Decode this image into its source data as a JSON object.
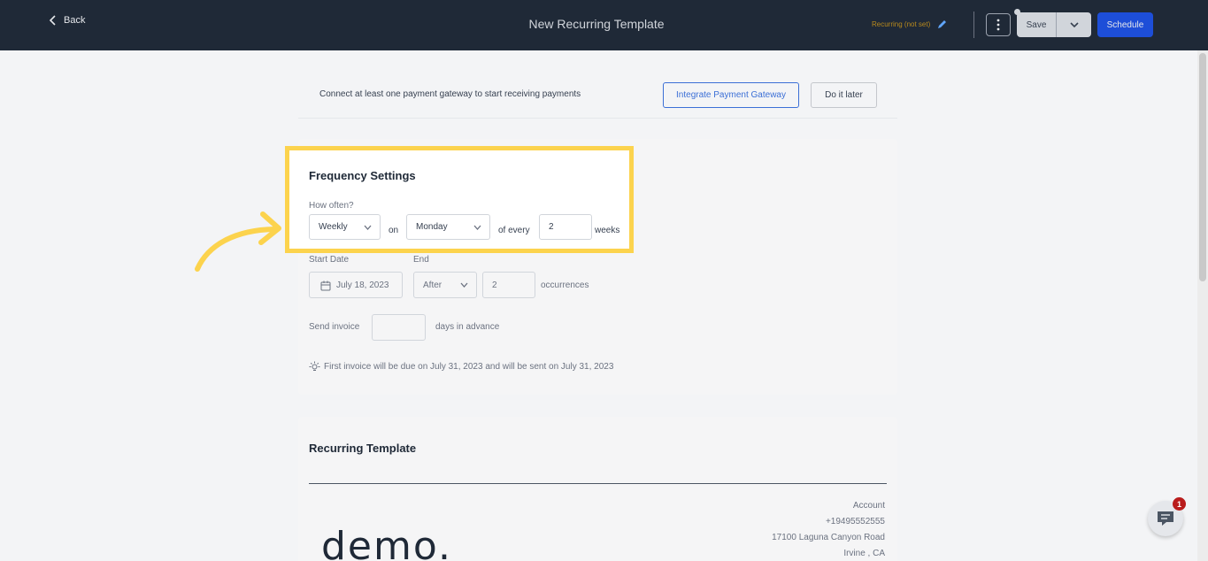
{
  "header": {
    "back_label": "Back",
    "title": "New Recurring Template",
    "status": "Recurring (not set)",
    "save_label": "Save",
    "schedule_label": "Schedule"
  },
  "banner": {
    "message": "Connect at least one payment gateway to start receiving payments",
    "integrate_label": "Integrate Payment Gateway",
    "later_label": "Do it later"
  },
  "frequency": {
    "title": "Frequency Settings",
    "how_often_label": "How often?",
    "interval": "Weekly",
    "on_label": "on",
    "day": "Monday",
    "of_every_label": "of every",
    "count": "2",
    "unit_label": "weeks"
  },
  "schedule": {
    "start_date_label": "Start Date",
    "start_date": "July 18, 2023",
    "end_label": "End",
    "end_type": "After",
    "occurrences": "2",
    "occurrences_label": "occurrences",
    "send_invoice_label": "Send invoice",
    "days_in_advance_value": "",
    "days_in_advance_label": "days in advance",
    "tip": "First invoice will be due on July 31, 2023 and will be sent on July 31, 2023"
  },
  "template": {
    "title": "Recurring Template",
    "logo_text": "demo.",
    "account": "Account",
    "phone": "+19495552555",
    "street": "17100 Laguna Canyon Road",
    "city": "Irvine , CA"
  },
  "chat": {
    "badge": "1"
  },
  "colors": {
    "header_bg": "#1f2937",
    "accent_blue": "#1d4ed8",
    "highlight": "#fcd34d",
    "status_amber": "#b98a1c"
  }
}
